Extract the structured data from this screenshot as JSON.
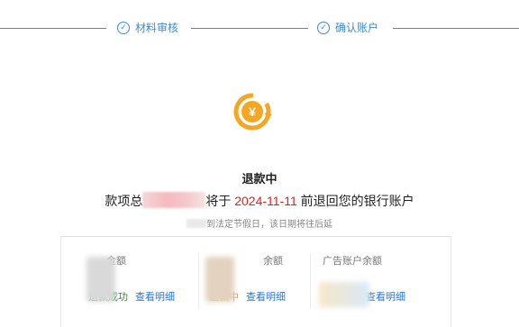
{
  "steps": [
    {
      "label": "材料审核",
      "icon": "check-circle-icon"
    },
    {
      "label": "确认账户",
      "icon": "check-circle-icon"
    }
  ],
  "status": {
    "title": "退款中",
    "message_prefix": "款项总",
    "message_mid": "将于",
    "date": "2024-11-11",
    "message_suffix": "前退回您的银行账户",
    "note": "到法定节假日，该日期将往后延"
  },
  "colors": {
    "accent": "#3b8bd9",
    "icon_orange": "#f5a623",
    "date_red": "#e0201a",
    "ok_green": "#2e8b3a",
    "link_blue": "#2b78d0"
  },
  "accounts": [
    {
      "label": "金额",
      "state": "退款成功",
      "detail_link": "查看明细"
    },
    {
      "label": "余额",
      "state": "退款中",
      "detail_link": "查看明细"
    },
    {
      "label": "广告账户余额",
      "state": "",
      "detail_link": "查看明细"
    }
  ]
}
